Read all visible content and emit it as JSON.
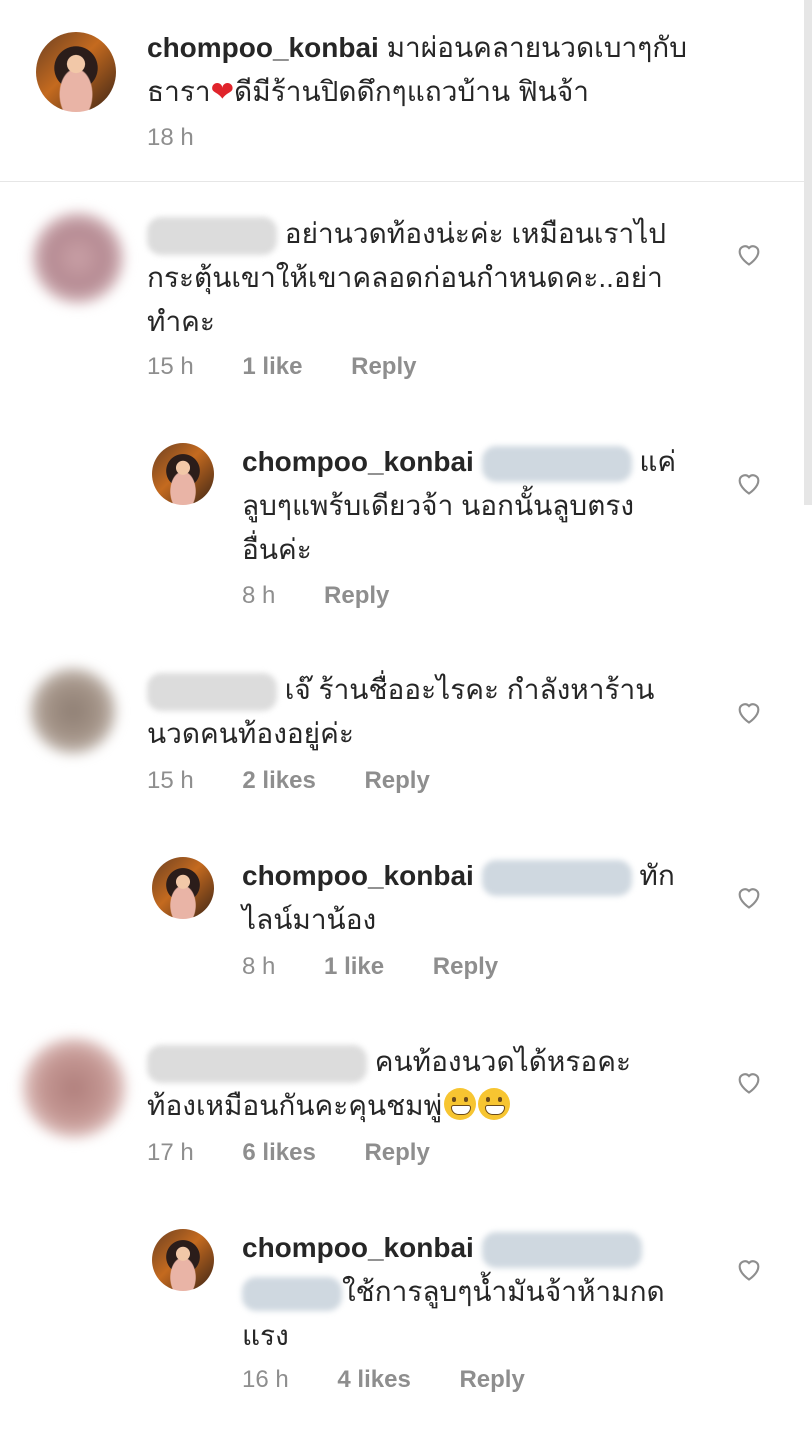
{
  "caption": {
    "username": "chompoo_konbai",
    "text_line1": "มาผ่อนคลายนวดเบาๆกับ",
    "text_line2a": "ธารา",
    "text_line2b": "ดีมีร้านปิดดึกๆแถวบ้าน ฟินจ้า",
    "time": "18 h"
  },
  "comments": [
    {
      "line1": "อย่านวดท้องน่ะค่ะ เหมือนเราไป",
      "line2": "กระตุ้นเขาให้เขาคลอดก่อนกำหนดคะ..อย่า",
      "line3": "ทำคะ",
      "time": "15 h",
      "likes": "1 like",
      "reply": "Reply"
    },
    {
      "username": "chompoo_konbai",
      "line1": "แค่",
      "line2": "ลูบๆแพร้บเดียวจ้า นอกนั้นลูบตรง",
      "line3": "อื่นค่ะ",
      "time": "8 h",
      "reply": "Reply"
    },
    {
      "line1": "เจ๊ ร้านชื่ออะไรคะ กำลังหาร้าน",
      "line2": "นวดคนท้องอยู่ค่ะ",
      "time": "15 h",
      "likes": "2 likes",
      "reply": "Reply"
    },
    {
      "username": "chompoo_konbai",
      "line1": "ทัก",
      "line2": "ไลน์มาน้อง",
      "time": "8 h",
      "likes": "1 like",
      "reply": "Reply"
    },
    {
      "line1": "คนท้องนวดได้หรอคะ",
      "line2": "ท้องเหมือนกันคะคุนชมพู่",
      "time": "17 h",
      "likes": "6 likes",
      "reply": "Reply"
    },
    {
      "username": "chompoo_konbai",
      "line2": "ใช้การลูบๆน้ำมันจ้าห้ามกด",
      "line3": "แรง",
      "time": "16 h",
      "likes": "4 likes",
      "reply": "Reply"
    }
  ],
  "icons": {
    "like": "heart-outline-icon"
  },
  "colors": {
    "text": "#262626",
    "meta": "#8e8e8e",
    "heart": "#8e8e8e"
  }
}
